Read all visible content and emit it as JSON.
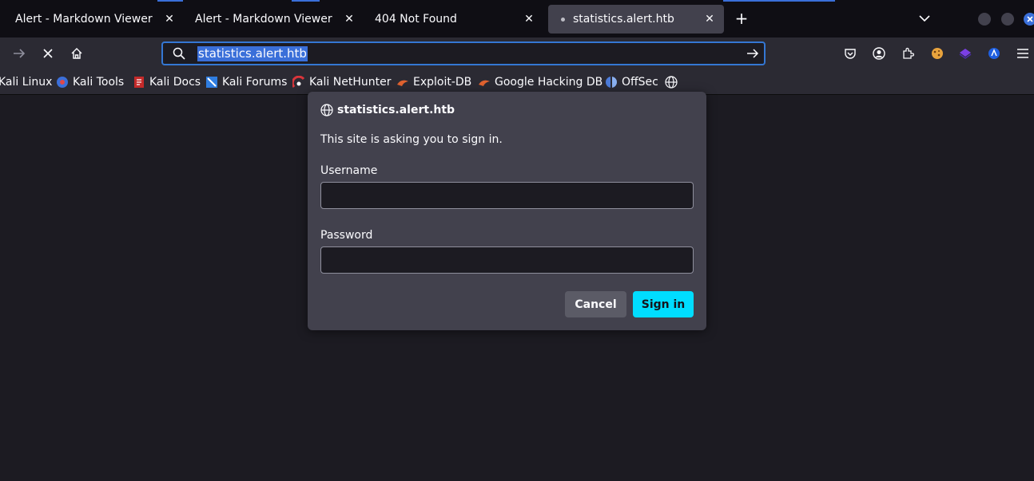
{
  "tabs": [
    {
      "title": "Alert - Markdown Viewer",
      "close": "✕"
    },
    {
      "title": "Alert - Markdown Viewer",
      "close": "✕"
    },
    {
      "title": "404 Not Found",
      "close": "✕"
    },
    {
      "title": "statistics.alert.htb",
      "close": "✕"
    }
  ],
  "new_tab": "+",
  "url": "statistics.alert.htb",
  "bookmarks": [
    "Kali Linux",
    "Kali Tools",
    "Kali Docs",
    "Kali Forums",
    "Kali NetHunter",
    "Exploit-DB",
    "Google Hacking DB",
    "OffSec"
  ],
  "dialog": {
    "host": "statistics.alert.htb",
    "message": "This site is asking you to sign in.",
    "username_label": "Username",
    "username_value": "",
    "password_label": "Password",
    "password_value": "",
    "cancel": "Cancel",
    "signin": "Sign in"
  },
  "colors": {
    "accent": "#00ddff",
    "url_selection": "#3a6fd9"
  },
  "icons": [
    "back-arrow-icon",
    "forward-arrow-icon",
    "stop-icon",
    "home-icon",
    "search-icon",
    "go-arrow-icon",
    "pocket-icon",
    "account-icon",
    "extensions-icon",
    "menu-icon",
    "globe-icon"
  ]
}
